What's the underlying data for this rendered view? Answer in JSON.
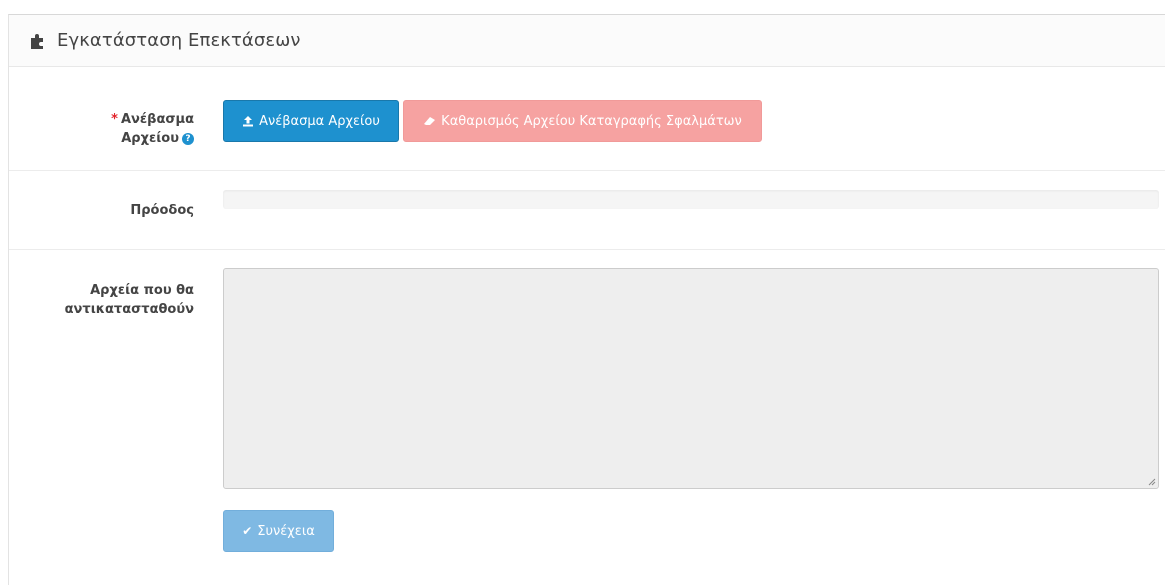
{
  "header": {
    "title": "Εγκατάσταση Επεκτάσεων",
    "icon": "puzzle-piece-icon"
  },
  "upload": {
    "required_mark": "*",
    "label_line1": "Ανέβασμα",
    "label_line2": "Αρχείου",
    "help_icon": "question-circle-icon",
    "upload_button": "Ανέβασμα Αρχείου",
    "clear_button": "Καθαρισμός Αρχείου Καταγραφής Σφαλμάτων"
  },
  "progress": {
    "label": "Πρόοδος",
    "value": 0
  },
  "overwrite": {
    "label_line1": "Αρχεία που θα",
    "label_line2": "αντικατασταθούν",
    "value": ""
  },
  "continue_button": "Συνέχεια",
  "colors": {
    "primary": "#1e91cf",
    "danger_light": "#f6a2a1",
    "continue_light": "#7fb9e3",
    "required": "#e2242b"
  }
}
